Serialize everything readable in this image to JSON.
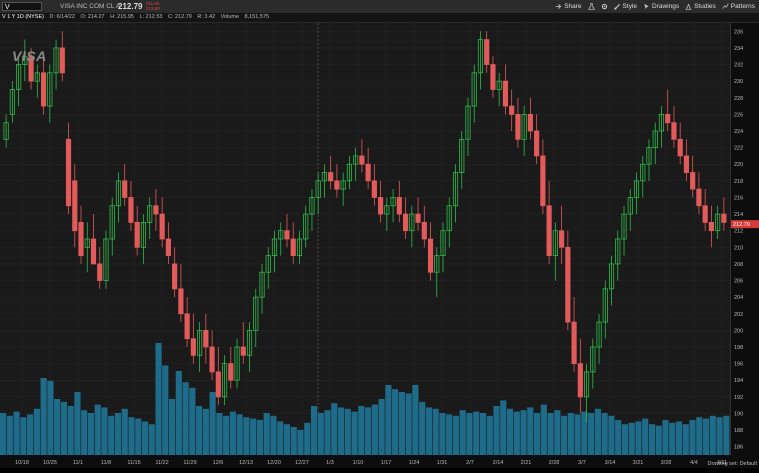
{
  "header": {
    "symbol": "V",
    "company": "VISA INC COM CL A",
    "price": "212.79",
    "bid": "211.60",
    "ask": "213.00",
    "buttons": [
      {
        "label": "Share",
        "icon": "share-icon"
      },
      {
        "label": "",
        "icon": "flask-icon"
      },
      {
        "label": "",
        "icon": "gear-icon"
      },
      {
        "label": "Style",
        "icon": "style-icon"
      },
      {
        "label": "Drawings",
        "icon": "cursor-icon"
      },
      {
        "label": "Studies",
        "icon": "studies-icon"
      },
      {
        "label": "Patterns",
        "icon": "patterns-icon"
      }
    ]
  },
  "info": {
    "timeframe": "V 1 Y 1D (NYSE)",
    "date": "D: 6/14/22",
    "open": "O: 214.27",
    "high": "H: 215.95",
    "low": "L: 212.53",
    "close": "C: 212.79",
    "range": "R: 3.42",
    "volume": "Volume",
    "volume_value": "8,151,575"
  },
  "logo_text": "VISA",
  "current_price_label": "212.79",
  "drawing_set": "Drawing set: Default",
  "colors": {
    "up": "#2ebd4a",
    "down": "#e35a5a",
    "volume": "#1f6b8a",
    "bg": "#1a1a1a"
  },
  "chart_data": {
    "type": "candlestick",
    "y_ticks": [
      186,
      188,
      190,
      192,
      194,
      196,
      198,
      200,
      202,
      204,
      206,
      208,
      210,
      212,
      214,
      216,
      218,
      220,
      222,
      224,
      226,
      228,
      230,
      232,
      234,
      236
    ],
    "ylim": [
      185,
      237
    ],
    "x_tick_labels": [
      "10/18",
      "10/25",
      "11/1",
      "11/8",
      "11/15",
      "11/22",
      "11/29",
      "12/6",
      "12/13",
      "12/20",
      "12/27",
      "1/3",
      "1/10",
      "1/17",
      "1/24",
      "1/31",
      "2/7",
      "2/14",
      "2/21",
      "2/28",
      "3/7",
      "3/14",
      "3/21",
      "3/28",
      "4/4",
      "4/11"
    ],
    "candles": [
      [
        223,
        226,
        222,
        225
      ],
      [
        226,
        230,
        225,
        229
      ],
      [
        229,
        233,
        227,
        232
      ],
      [
        232,
        235,
        230,
        233
      ],
      [
        233,
        234,
        229,
        230
      ],
      [
        230,
        232,
        228,
        231
      ],
      [
        231,
        233,
        226,
        227
      ],
      [
        227,
        232,
        225,
        231
      ],
      [
        231,
        235,
        229,
        234
      ],
      [
        234,
        236,
        230,
        231
      ],
      [
        223,
        225,
        214,
        215
      ],
      [
        218,
        220,
        210,
        212
      ],
      [
        213,
        215,
        208,
        209
      ],
      [
        210,
        213,
        207,
        211
      ],
      [
        211,
        214,
        208,
        208
      ],
      [
        208,
        210,
        205,
        206
      ],
      [
        206,
        212,
        205,
        211
      ],
      [
        211,
        216,
        209,
        215
      ],
      [
        215,
        219,
        213,
        218
      ],
      [
        218,
        220,
        215,
        216
      ],
      [
        216,
        218,
        212,
        213
      ],
      [
        213,
        215,
        209,
        210
      ],
      [
        210,
        214,
        208,
        213
      ],
      [
        213,
        216,
        211,
        215
      ],
      [
        215,
        217,
        212,
        214
      ],
      [
        214,
        216,
        210,
        211
      ],
      [
        211,
        213,
        208,
        209
      ],
      [
        208,
        210,
        204,
        205
      ],
      [
        205,
        208,
        201,
        202
      ],
      [
        202,
        204,
        198,
        199
      ],
      [
        199,
        202,
        196,
        197
      ],
      [
        197,
        201,
        195,
        200
      ],
      [
        200,
        202,
        196,
        198
      ],
      [
        198,
        200,
        194,
        195
      ],
      [
        195,
        198,
        191,
        192
      ],
      [
        192,
        197,
        191,
        196
      ],
      [
        196,
        198,
        193,
        194
      ],
      [
        194,
        199,
        193,
        198
      ],
      [
        198,
        201,
        196,
        197
      ],
      [
        197,
        201,
        195,
        200
      ],
      [
        200,
        205,
        198,
        204
      ],
      [
        204,
        208,
        202,
        207
      ],
      [
        207,
        210,
        205,
        209
      ],
      [
        209,
        212,
        207,
        211
      ],
      [
        211,
        213,
        209,
        212
      ],
      [
        212,
        214,
        210,
        211
      ],
      [
        211,
        213,
        208,
        209
      ],
      [
        209,
        212,
        208,
        211
      ],
      [
        211,
        215,
        210,
        214
      ],
      [
        214,
        217,
        212,
        216
      ],
      [
        216,
        219,
        214,
        218
      ],
      [
        218,
        220,
        216,
        219
      ],
      [
        219,
        221,
        217,
        218
      ],
      [
        218,
        220,
        216,
        217
      ],
      [
        217,
        219,
        215,
        218
      ],
      [
        218,
        221,
        217,
        220
      ],
      [
        220,
        222,
        218,
        221
      ],
      [
        221,
        223,
        219,
        220
      ],
      [
        220,
        222,
        217,
        218
      ],
      [
        218,
        220,
        215,
        216
      ],
      [
        216,
        218,
        213,
        214
      ],
      [
        214,
        216,
        212,
        215
      ],
      [
        215,
        217,
        213,
        216
      ],
      [
        216,
        218,
        213,
        214
      ],
      [
        214,
        216,
        211,
        212
      ],
      [
        212,
        215,
        210,
        214
      ],
      [
        214,
        216,
        212,
        213
      ],
      [
        213,
        215,
        210,
        211
      ],
      [
        211,
        213,
        206,
        207
      ],
      [
        207,
        210,
        204,
        209
      ],
      [
        209,
        213,
        207,
        212
      ],
      [
        212,
        216,
        210,
        215
      ],
      [
        215,
        220,
        213,
        219
      ],
      [
        219,
        224,
        217,
        223
      ],
      [
        223,
        228,
        221,
        227
      ],
      [
        227,
        232,
        225,
        231
      ],
      [
        231,
        236,
        229,
        235
      ],
      [
        235,
        236,
        231,
        232
      ],
      [
        232,
        233,
        228,
        229
      ],
      [
        229,
        231,
        227,
        230
      ],
      [
        230,
        232,
        226,
        227
      ],
      [
        227,
        229,
        224,
        226
      ],
      [
        226,
        228,
        222,
        223
      ],
      [
        223,
        227,
        221,
        226
      ],
      [
        226,
        228,
        223,
        224
      ],
      [
        224,
        226,
        220,
        221
      ],
      [
        221,
        223,
        214,
        215
      ],
      [
        215,
        218,
        208,
        209
      ],
      [
        209,
        213,
        206,
        212
      ],
      [
        212,
        215,
        208,
        210
      ],
      [
        210,
        212,
        200,
        201
      ],
      [
        201,
        204,
        195,
        196
      ],
      [
        196,
        199,
        190,
        192
      ],
      [
        192,
        196,
        189,
        195
      ],
      [
        195,
        199,
        193,
        198
      ],
      [
        198,
        202,
        196,
        201
      ],
      [
        201,
        206,
        199,
        205
      ],
      [
        205,
        209,
        203,
        208
      ],
      [
        208,
        212,
        206,
        211
      ],
      [
        211,
        215,
        209,
        214
      ],
      [
        214,
        217,
        212,
        216
      ],
      [
        216,
        219,
        214,
        218
      ],
      [
        218,
        221,
        216,
        220
      ],
      [
        220,
        223,
        218,
        222
      ],
      [
        222,
        225,
        220,
        224
      ],
      [
        224,
        227,
        222,
        226
      ],
      [
        226,
        229,
        224,
        225
      ],
      [
        225,
        227,
        222,
        223
      ],
      [
        223,
        225,
        220,
        221
      ],
      [
        221,
        223,
        218,
        219
      ],
      [
        219,
        221,
        216,
        217
      ],
      [
        217,
        219,
        214,
        215
      ],
      [
        215,
        217,
        212,
        213
      ],
      [
        213,
        215,
        210,
        212
      ],
      [
        212,
        215,
        211,
        214
      ],
      [
        214,
        216,
        212,
        213
      ]
    ],
    "volume_label": "Volume",
    "volume_relative": [
      0.3,
      0.28,
      0.31,
      0.27,
      0.29,
      0.33,
      0.55,
      0.53,
      0.4,
      0.38,
      0.35,
      0.45,
      0.32,
      0.3,
      0.36,
      0.34,
      0.28,
      0.3,
      0.33,
      0.27,
      0.26,
      0.24,
      0.22,
      0.8,
      0.64,
      0.4,
      0.6,
      0.52,
      0.48,
      0.35,
      0.33,
      0.45,
      0.3,
      0.28,
      0.31,
      0.29,
      0.27,
      0.26,
      0.25,
      0.3,
      0.28,
      0.24,
      0.22,
      0.2,
      0.18,
      0.23,
      0.35,
      0.3,
      0.32,
      0.37,
      0.34,
      0.33,
      0.31,
      0.35,
      0.34,
      0.36,
      0.4,
      0.5,
      0.47,
      0.45,
      0.44,
      0.5,
      0.38,
      0.34,
      0.33,
      0.3,
      0.29,
      0.28,
      0.32,
      0.3,
      0.31,
      0.3,
      0.28,
      0.35,
      0.39,
      0.33,
      0.31,
      0.32,
      0.34,
      0.3,
      0.36,
      0.3,
      0.32,
      0.28,
      0.3,
      0.29,
      0.31,
      0.3,
      0.33,
      0.3,
      0.28,
      0.25,
      0.22,
      0.23,
      0.24,
      0.26,
      0.22,
      0.21,
      0.25,
      0.23,
      0.24,
      0.22,
      0.25,
      0.27,
      0.26,
      0.28,
      0.27,
      0.28
    ]
  }
}
